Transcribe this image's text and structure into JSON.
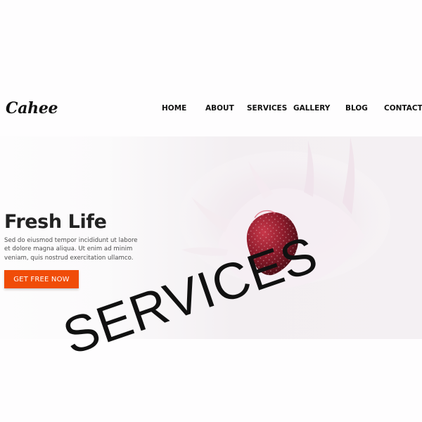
{
  "brand": {
    "logo_text": "Cahee"
  },
  "nav": {
    "home": "HOME",
    "about": "ABOUT",
    "services": "SERVICES",
    "gallery": "GALLERY",
    "blog": "BLOG",
    "contact": "CONTACT"
  },
  "hero": {
    "title": "Fresh Life",
    "description": "Sed do eiusmod tempor incididunt ut labore et dolore magna aliqua. Ut enim ad minim veniam, quis nostrud exercitation ullamco.",
    "button_label": "GET FREE NOW",
    "accent_color": "#f04c08",
    "image_name": "strawberry-milk-splash-icon"
  },
  "overlay": {
    "watermark_text": "SERVICES"
  }
}
